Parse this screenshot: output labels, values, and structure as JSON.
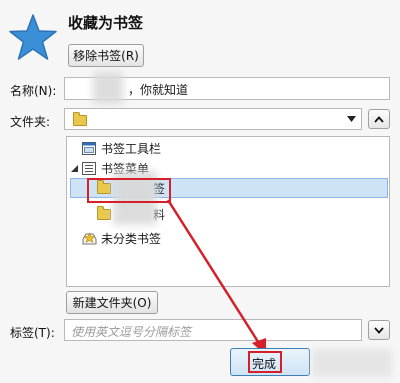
{
  "dialog": {
    "title": "收藏为书签",
    "remove_button": "移除书签(R)",
    "name_label": "名称(N):",
    "name_value_suffix": "，你就知道",
    "folder_label": "文件夹:",
    "tags_label": "标签(T):",
    "tags_placeholder": "使用英文逗号分隔标签",
    "new_folder_button": "新建文件夹(O)",
    "done_button": "完成"
  },
  "tree": {
    "items": [
      {
        "label": "书签工具栏"
      },
      {
        "label": "书签菜单"
      },
      {
        "label": "签"
      },
      {
        "label": "料"
      },
      {
        "label": "未分类书签"
      }
    ]
  },
  "colors": {
    "star": "#3a8fd6",
    "selection": "#cfe3f7",
    "highlight_red": "#d5202a"
  }
}
